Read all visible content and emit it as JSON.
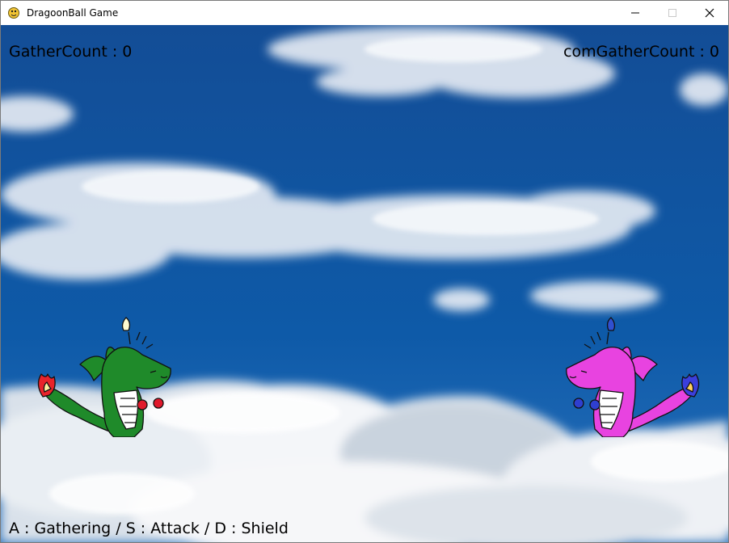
{
  "window": {
    "title": "DragoonBall Game",
    "icon": "pygame-snake-icon",
    "controls": [
      "minimize-icon",
      "maximize-icon",
      "close-icon"
    ]
  },
  "hud": {
    "player_gather": "GatherCount : 0",
    "com_gather": "comGatherCount : 0",
    "controls_help": "A : Gathering / S : Attack / D : Shield"
  },
  "characters": {
    "player": {
      "body_color": "#1f8a2a",
      "flame_color": "#e8232b",
      "glove_color": "#e0192c",
      "crest_color": "#fffbd0"
    },
    "computer": {
      "body_color": "#e843e0",
      "flame_color": "#3b3fdc",
      "glove_color": "#2f3fd0",
      "crest_color": "#3050d0"
    }
  },
  "colors": {
    "sky": "#0f4f9b",
    "cloud": "#f2f4f7"
  }
}
